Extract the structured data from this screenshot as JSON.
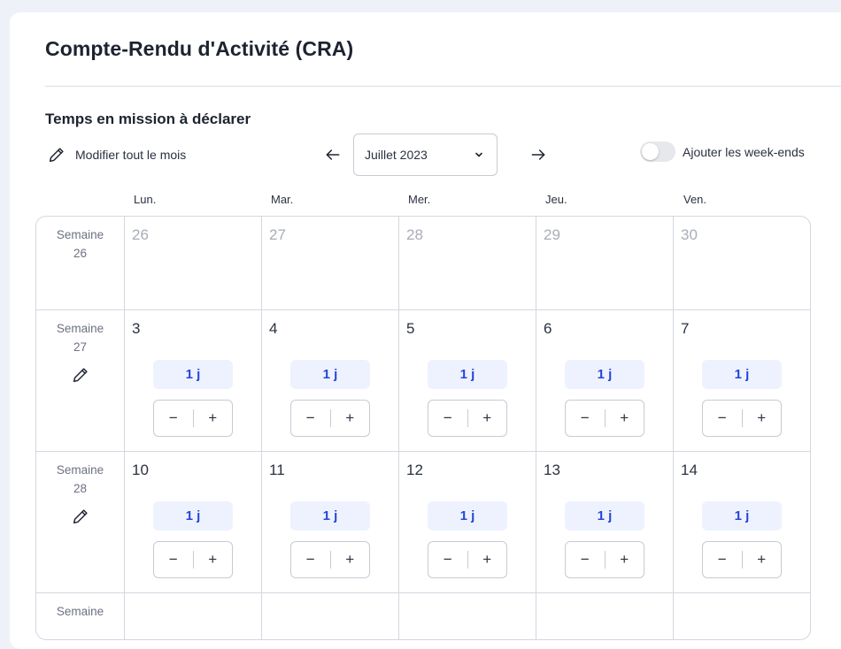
{
  "header": {
    "title": "Compte-Rendu d'Activité (CRA)"
  },
  "section": {
    "title": "Temps en mission à déclarer"
  },
  "toolbar": {
    "edit_month_label": "Modifier tout le mois",
    "month_value": "Juillet 2023",
    "weekend_toggle_label": "Ajouter les week-ends",
    "weekend_toggle_on": false
  },
  "calendar": {
    "day_headers": [
      "Lun.",
      "Mar.",
      "Mer.",
      "Jeu.",
      "Ven."
    ],
    "weeks": [
      {
        "label": "Semaine",
        "number": "26",
        "editable": false,
        "days": [
          {
            "day": "26",
            "muted": true
          },
          {
            "day": "27",
            "muted": true
          },
          {
            "day": "28",
            "muted": true
          },
          {
            "day": "29",
            "muted": true
          },
          {
            "day": "30",
            "muted": true
          }
        ]
      },
      {
        "label": "Semaine",
        "number": "27",
        "editable": true,
        "days": [
          {
            "day": "3",
            "value": "1 j"
          },
          {
            "day": "4",
            "value": "1 j"
          },
          {
            "day": "5",
            "value": "1 j"
          },
          {
            "day": "6",
            "value": "1 j"
          },
          {
            "day": "7",
            "value": "1 j"
          }
        ]
      },
      {
        "label": "Semaine",
        "number": "28",
        "editable": true,
        "days": [
          {
            "day": "10",
            "value": "1 j"
          },
          {
            "day": "11",
            "value": "1 j"
          },
          {
            "day": "12",
            "value": "1 j"
          },
          {
            "day": "13",
            "value": "1 j"
          },
          {
            "day": "14",
            "value": "1 j"
          }
        ]
      },
      {
        "label": "Semaine",
        "number": "",
        "editable": false,
        "days": [
          {
            "day": ""
          },
          {
            "day": ""
          },
          {
            "day": ""
          },
          {
            "day": ""
          },
          {
            "day": ""
          }
        ]
      }
    ],
    "stepper": {
      "minus": "−",
      "plus": "+"
    }
  },
  "icons": {
    "edit": "pencil-icon",
    "prev": "arrow-left-icon",
    "next": "arrow-right-icon",
    "dropdown": "chevron-down-icon"
  },
  "colors": {
    "accent_text": "#2447d8",
    "badge_bg": "#eef2ff",
    "page_bg": "#eef2f8",
    "border": "#d3d7df"
  }
}
